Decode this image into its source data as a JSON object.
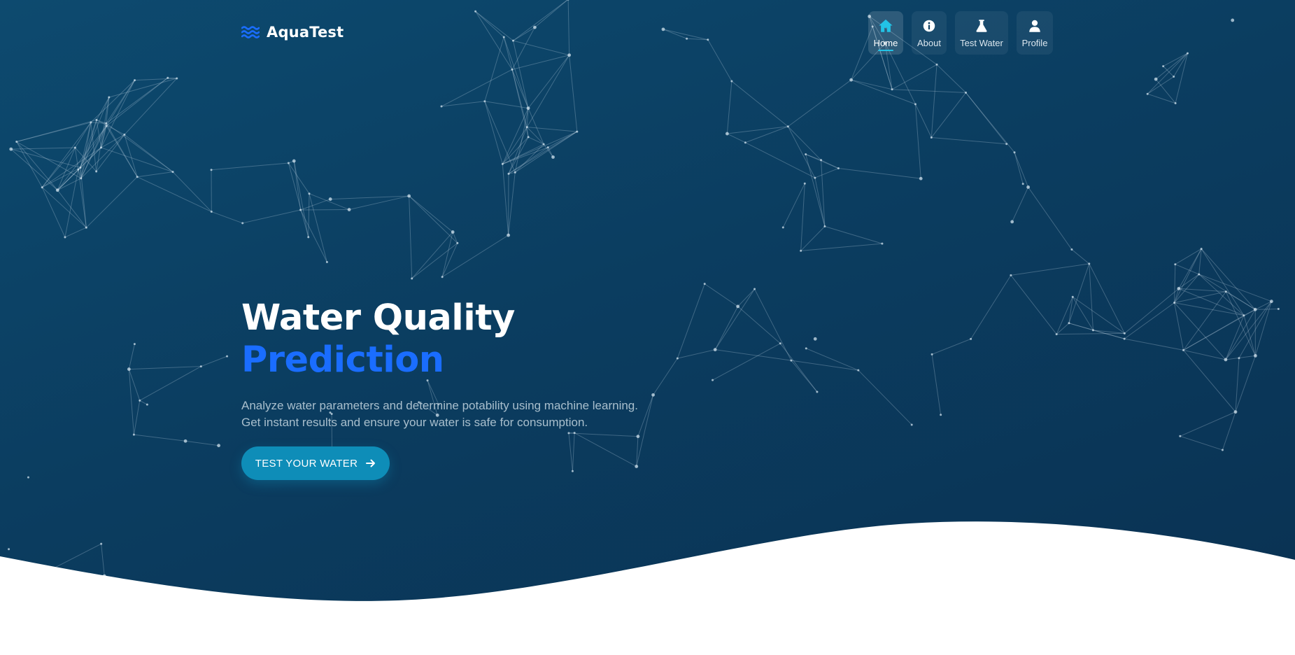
{
  "brand": {
    "name": "AquaTest",
    "logo_icon": "waves-icon",
    "logo_color": "#1a6dff"
  },
  "nav": {
    "items": [
      {
        "label": "Home",
        "icon": "home-icon",
        "active": true
      },
      {
        "label": "About",
        "icon": "info-icon",
        "active": false
      },
      {
        "label": "Test Water",
        "icon": "flask-icon",
        "active": false
      },
      {
        "label": "Profile",
        "icon": "user-icon",
        "active": false
      }
    ],
    "accent_color": "#22c3e6"
  },
  "hero": {
    "title_line1": "Water Quality",
    "title_line2": "Prediction",
    "subtitle_line1": "Analyze water parameters and determine potability using machine learning.",
    "subtitle_line2": "Get instant results and ensure your water is safe for consumption.",
    "cta_label": "TEST YOUR WATER",
    "cta_icon": "arrow-right-icon"
  },
  "colors": {
    "background": "#0b3d60",
    "title_accent": "#1a6dff",
    "button": "#0e8db8",
    "wave": "#ffffff"
  }
}
